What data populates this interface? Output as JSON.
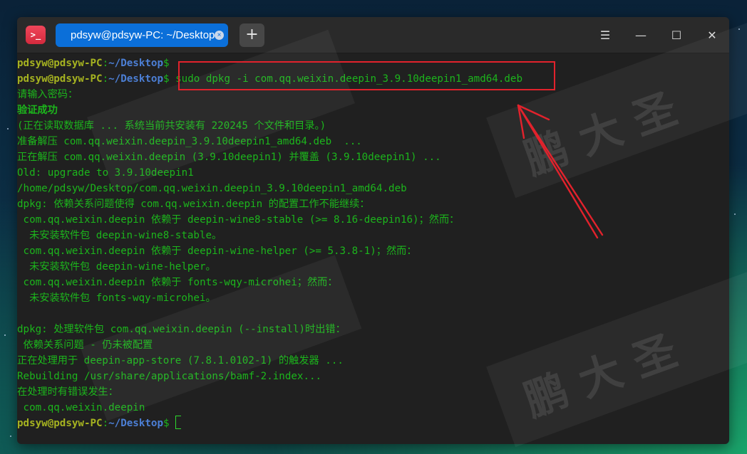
{
  "window": {
    "tab_title": "pdsyw@pdsyw-PC: ~/Desktop",
    "add_tab": "+",
    "close_tab": "×",
    "menu_icon": "hamburger-icon",
    "minimize_icon": "minimize-icon",
    "maximize_icon": "maximize-icon",
    "close_icon": "close-icon"
  },
  "prompt": {
    "user": "pdsyw@pdsyw-PC",
    "sep": ":",
    "path": "~/Desktop",
    "dollar": "$"
  },
  "command": "sudo dpkg -i com.qq.weixin.deepin_3.9.10deepin1_amd64.deb",
  "output": [
    "请输入密码：",
    "验证成功",
    "(正在读取数据库 ... 系统当前共安装有 220245 个文件和目录。)",
    "准备解压 com.qq.weixin.deepin_3.9.10deepin1_amd64.deb  ...",
    "正在解压 com.qq.weixin.deepin (3.9.10deepin1) 并覆盖 (3.9.10deepin1) ...",
    "Old: upgrade to 3.9.10deepin1",
    "/home/pdsyw/Desktop/com.qq.weixin.deepin_3.9.10deepin1_amd64.deb",
    "dpkg: 依赖关系问题使得 com.qq.weixin.deepin 的配置工作不能继续：",
    " com.qq.weixin.deepin 依赖于 deepin-wine8-stable (>= 8.16-deepin16)；然而：",
    "  未安装软件包 deepin-wine8-stable。",
    " com.qq.weixin.deepin 依赖于 deepin-wine-helper (>= 5.3.8-1)；然而：",
    "  未安装软件包 deepin-wine-helper。",
    " com.qq.weixin.deepin 依赖于 fonts-wqy-microhei；然而：",
    "  未安装软件包 fonts-wqy-microhei。",
    "",
    "dpkg: 处理软件包 com.qq.weixin.deepin (--install)时出错：",
    " 依赖关系问题 - 仍未被配置",
    "正在处理用于 deepin-app-store (7.8.1.0102-1) 的触发器 ...",
    "Rebuilding /usr/share/applications/bamf-2.index...",
    "在处理时有错误发生：",
    " com.qq.weixin.deepin"
  ],
  "watermark": "鹏 大 圣",
  "colors": {
    "prompt_user": "#a6b320",
    "prompt_path": "#4c7fd5",
    "terminal_text": "#1cb51c",
    "tab_active": "#0b6fd9",
    "annotation_red": "#e2222c"
  }
}
